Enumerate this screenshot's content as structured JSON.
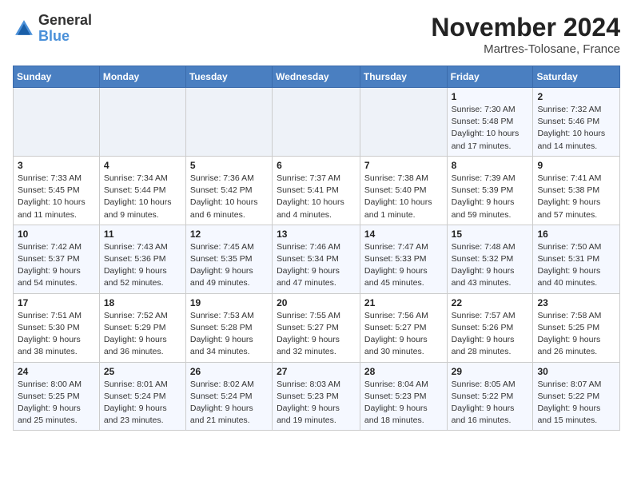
{
  "header": {
    "logo_general": "General",
    "logo_blue": "Blue",
    "month_title": "November 2024",
    "location": "Martres-Tolosane, France"
  },
  "weekdays": [
    "Sunday",
    "Monday",
    "Tuesday",
    "Wednesday",
    "Thursday",
    "Friday",
    "Saturday"
  ],
  "rows": [
    [
      {
        "day": "",
        "info": ""
      },
      {
        "day": "",
        "info": ""
      },
      {
        "day": "",
        "info": ""
      },
      {
        "day": "",
        "info": ""
      },
      {
        "day": "",
        "info": ""
      },
      {
        "day": "1",
        "info": "Sunrise: 7:30 AM\nSunset: 5:48 PM\nDaylight: 10 hours and 17 minutes."
      },
      {
        "day": "2",
        "info": "Sunrise: 7:32 AM\nSunset: 5:46 PM\nDaylight: 10 hours and 14 minutes."
      }
    ],
    [
      {
        "day": "3",
        "info": "Sunrise: 7:33 AM\nSunset: 5:45 PM\nDaylight: 10 hours and 11 minutes."
      },
      {
        "day": "4",
        "info": "Sunrise: 7:34 AM\nSunset: 5:44 PM\nDaylight: 10 hours and 9 minutes."
      },
      {
        "day": "5",
        "info": "Sunrise: 7:36 AM\nSunset: 5:42 PM\nDaylight: 10 hours and 6 minutes."
      },
      {
        "day": "6",
        "info": "Sunrise: 7:37 AM\nSunset: 5:41 PM\nDaylight: 10 hours and 4 minutes."
      },
      {
        "day": "7",
        "info": "Sunrise: 7:38 AM\nSunset: 5:40 PM\nDaylight: 10 hours and 1 minute."
      },
      {
        "day": "8",
        "info": "Sunrise: 7:39 AM\nSunset: 5:39 PM\nDaylight: 9 hours and 59 minutes."
      },
      {
        "day": "9",
        "info": "Sunrise: 7:41 AM\nSunset: 5:38 PM\nDaylight: 9 hours and 57 minutes."
      }
    ],
    [
      {
        "day": "10",
        "info": "Sunrise: 7:42 AM\nSunset: 5:37 PM\nDaylight: 9 hours and 54 minutes."
      },
      {
        "day": "11",
        "info": "Sunrise: 7:43 AM\nSunset: 5:36 PM\nDaylight: 9 hours and 52 minutes."
      },
      {
        "day": "12",
        "info": "Sunrise: 7:45 AM\nSunset: 5:35 PM\nDaylight: 9 hours and 49 minutes."
      },
      {
        "day": "13",
        "info": "Sunrise: 7:46 AM\nSunset: 5:34 PM\nDaylight: 9 hours and 47 minutes."
      },
      {
        "day": "14",
        "info": "Sunrise: 7:47 AM\nSunset: 5:33 PM\nDaylight: 9 hours and 45 minutes."
      },
      {
        "day": "15",
        "info": "Sunrise: 7:48 AM\nSunset: 5:32 PM\nDaylight: 9 hours and 43 minutes."
      },
      {
        "day": "16",
        "info": "Sunrise: 7:50 AM\nSunset: 5:31 PM\nDaylight: 9 hours and 40 minutes."
      }
    ],
    [
      {
        "day": "17",
        "info": "Sunrise: 7:51 AM\nSunset: 5:30 PM\nDaylight: 9 hours and 38 minutes."
      },
      {
        "day": "18",
        "info": "Sunrise: 7:52 AM\nSunset: 5:29 PM\nDaylight: 9 hours and 36 minutes."
      },
      {
        "day": "19",
        "info": "Sunrise: 7:53 AM\nSunset: 5:28 PM\nDaylight: 9 hours and 34 minutes."
      },
      {
        "day": "20",
        "info": "Sunrise: 7:55 AM\nSunset: 5:27 PM\nDaylight: 9 hours and 32 minutes."
      },
      {
        "day": "21",
        "info": "Sunrise: 7:56 AM\nSunset: 5:27 PM\nDaylight: 9 hours and 30 minutes."
      },
      {
        "day": "22",
        "info": "Sunrise: 7:57 AM\nSunset: 5:26 PM\nDaylight: 9 hours and 28 minutes."
      },
      {
        "day": "23",
        "info": "Sunrise: 7:58 AM\nSunset: 5:25 PM\nDaylight: 9 hours and 26 minutes."
      }
    ],
    [
      {
        "day": "24",
        "info": "Sunrise: 8:00 AM\nSunset: 5:25 PM\nDaylight: 9 hours and 25 minutes."
      },
      {
        "day": "25",
        "info": "Sunrise: 8:01 AM\nSunset: 5:24 PM\nDaylight: 9 hours and 23 minutes."
      },
      {
        "day": "26",
        "info": "Sunrise: 8:02 AM\nSunset: 5:24 PM\nDaylight: 9 hours and 21 minutes."
      },
      {
        "day": "27",
        "info": "Sunrise: 8:03 AM\nSunset: 5:23 PM\nDaylight: 9 hours and 19 minutes."
      },
      {
        "day": "28",
        "info": "Sunrise: 8:04 AM\nSunset: 5:23 PM\nDaylight: 9 hours and 18 minutes."
      },
      {
        "day": "29",
        "info": "Sunrise: 8:05 AM\nSunset: 5:22 PM\nDaylight: 9 hours and 16 minutes."
      },
      {
        "day": "30",
        "info": "Sunrise: 8:07 AM\nSunset: 5:22 PM\nDaylight: 9 hours and 15 minutes."
      }
    ]
  ]
}
